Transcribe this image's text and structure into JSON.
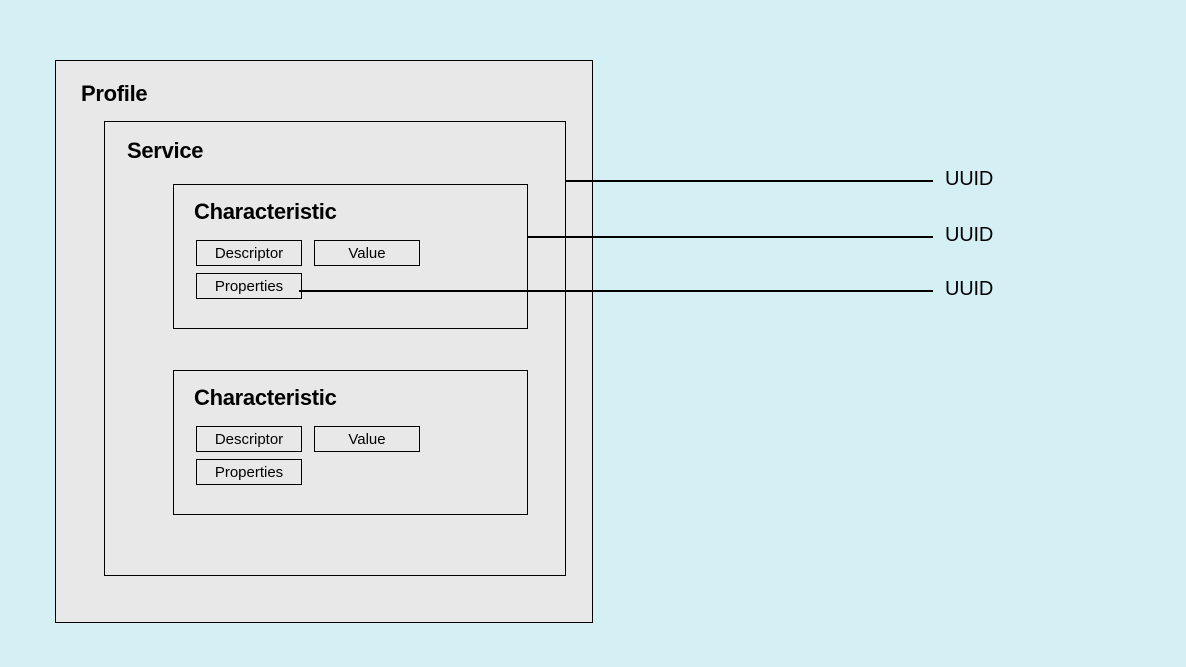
{
  "profile": {
    "title": "Profile"
  },
  "service": {
    "title": "Service"
  },
  "characteristics": [
    {
      "title": "Characteristic",
      "descriptor": "Descriptor",
      "value": "Value",
      "properties": "Properties"
    },
    {
      "title": "Characteristic",
      "descriptor": "Descriptor",
      "value": "Value",
      "properties": "Properties"
    }
  ],
  "callouts": {
    "uuid1": "UUID",
    "uuid2": "UUID",
    "uuid3": "UUID"
  }
}
